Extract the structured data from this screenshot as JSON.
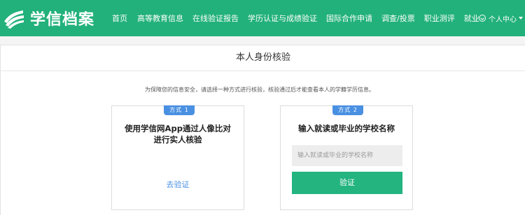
{
  "header": {
    "logo_text": "学信档案",
    "nav": [
      {
        "label": "首页"
      },
      {
        "label": "高等教育信息"
      },
      {
        "label": "在线验证报告"
      },
      {
        "label": "学历认证与成绩验证"
      },
      {
        "label": "国际合作申请"
      },
      {
        "label": "调查/投票"
      },
      {
        "label": "职业测评"
      },
      {
        "label": "就业"
      }
    ],
    "user_center": "个人中心"
  },
  "page": {
    "title": "本人身份核验",
    "notice": "为保障您的信息安全，请选择一种方式进行核验，核验通过后才能查看本人的学籍学历信息。"
  },
  "method1": {
    "badge": "方式 1",
    "title_line1": "使用学信网App通过人像比对",
    "title_line2": "进行实人核验",
    "link": "去验证"
  },
  "method2": {
    "badge": "方式 2",
    "title": "输入就读或毕业的学校名称",
    "input_placeholder": "输入就读或毕业的学校名称",
    "input_value": "",
    "button": "验证"
  },
  "colors": {
    "header_bg": "#22b17a",
    "badge_bg": "#4a90e2",
    "button_bg": "#23b480",
    "link": "#4a90e2"
  }
}
